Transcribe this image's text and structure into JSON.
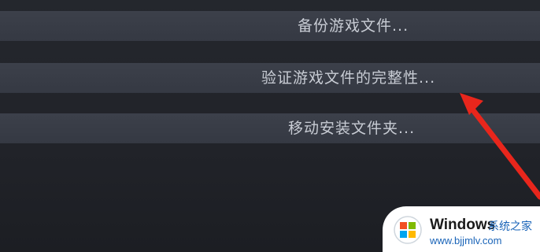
{
  "menu": {
    "items": [
      {
        "label": "备份游戏文件..."
      },
      {
        "label": "验证游戏文件的完整性..."
      },
      {
        "label": "移动安装文件夹..."
      }
    ]
  },
  "annotation": {
    "arrow_color": "#e8261c",
    "points_to": "验证游戏文件的完整性..."
  },
  "watermark": {
    "brand": "Windows",
    "brand_sub": "系统之家",
    "url": "www.bjjmlv.com",
    "logo_colors": [
      "#f25022",
      "#7fba00",
      "#00a4ef",
      "#ffb900"
    ]
  }
}
